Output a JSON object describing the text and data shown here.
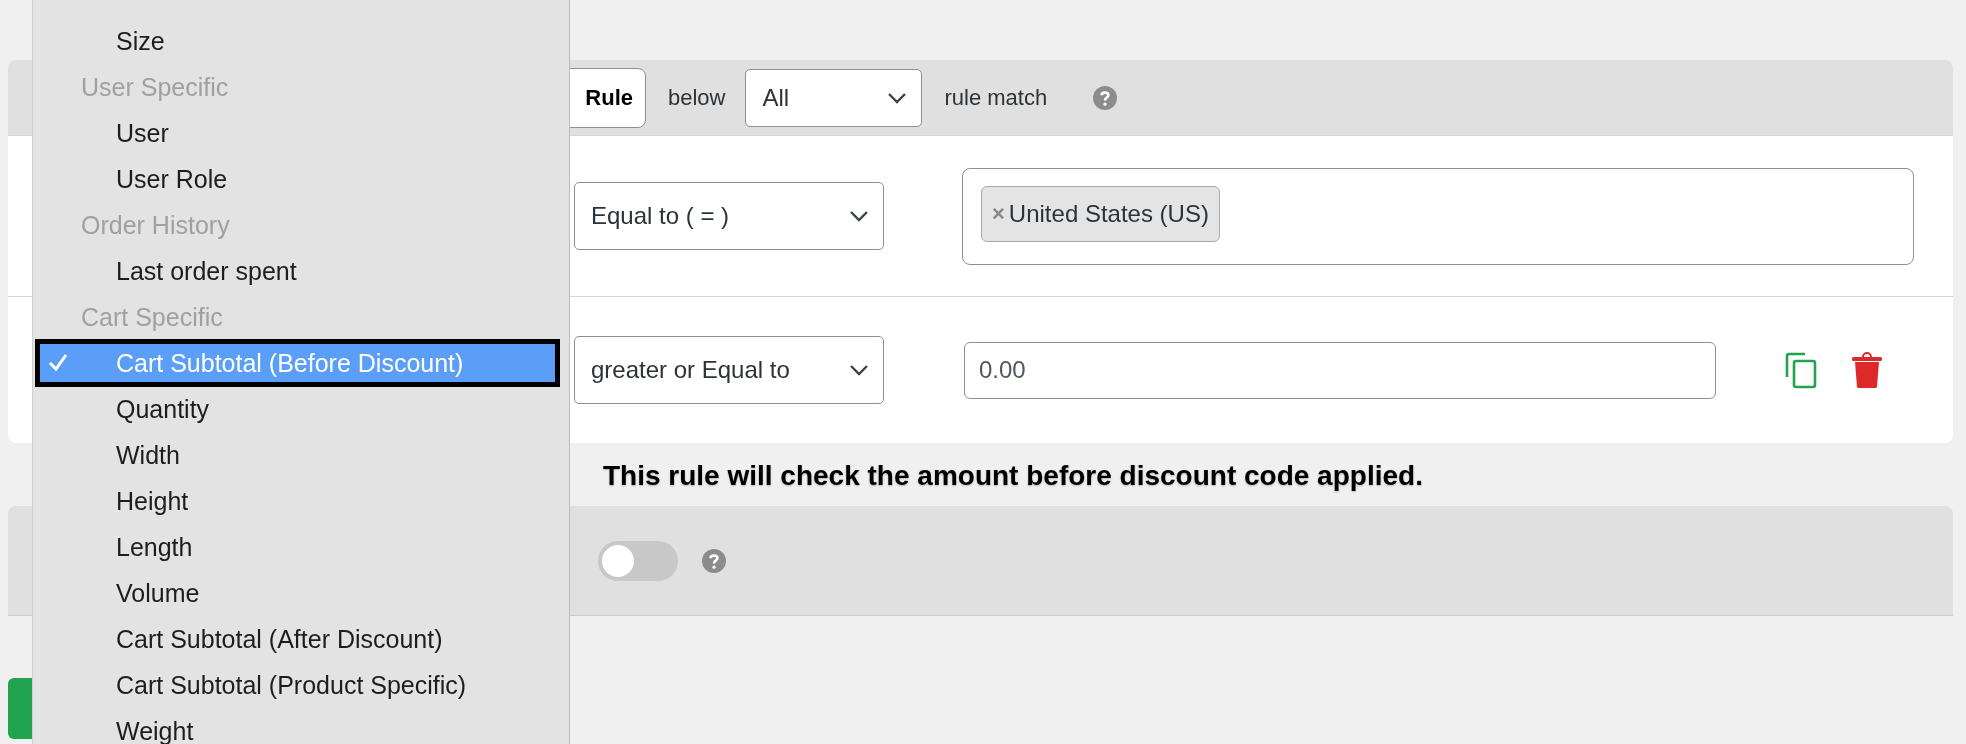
{
  "header": {
    "rule_button": "Rule",
    "below_label": "below",
    "match_select": "All",
    "match_label": "rule match"
  },
  "conditions": [
    {
      "operator": "Equal to ( = )",
      "kind": "tags",
      "tags": [
        {
          "remove": "×",
          "label": "United States (US)"
        }
      ],
      "show_actions": false
    },
    {
      "operator": "greater or Equal to",
      "kind": "number",
      "value": "0.00",
      "show_actions": true
    }
  ],
  "note": "This rule will check the amount before discount code applied.",
  "option_panel": {
    "toggle": {
      "on": false
    }
  },
  "dropdown": {
    "items": [
      {
        "label": "Size",
        "kind": "option",
        "selected": false
      },
      {
        "label": "User Specific",
        "kind": "group"
      },
      {
        "label": "User",
        "kind": "option",
        "selected": false
      },
      {
        "label": "User Role",
        "kind": "option",
        "selected": false
      },
      {
        "label": "Order History",
        "kind": "group"
      },
      {
        "label": "Last order spent",
        "kind": "option",
        "selected": false
      },
      {
        "label": "Cart Specific",
        "kind": "group"
      },
      {
        "label": "Cart Subtotal (Before Discount)",
        "kind": "option",
        "selected": true
      },
      {
        "label": "Quantity",
        "kind": "option",
        "selected": false
      },
      {
        "label": "Width",
        "kind": "option",
        "selected": false
      },
      {
        "label": "Height",
        "kind": "option",
        "selected": false
      },
      {
        "label": "Length",
        "kind": "option",
        "selected": false
      },
      {
        "label": "Volume",
        "kind": "option",
        "selected": false
      },
      {
        "label": "Cart Subtotal (After Discount)",
        "kind": "option",
        "selected": false
      },
      {
        "label": "Cart Subtotal (Product Specific)",
        "kind": "option",
        "selected": false
      },
      {
        "label": "Weight",
        "kind": "option",
        "selected": false
      }
    ]
  }
}
